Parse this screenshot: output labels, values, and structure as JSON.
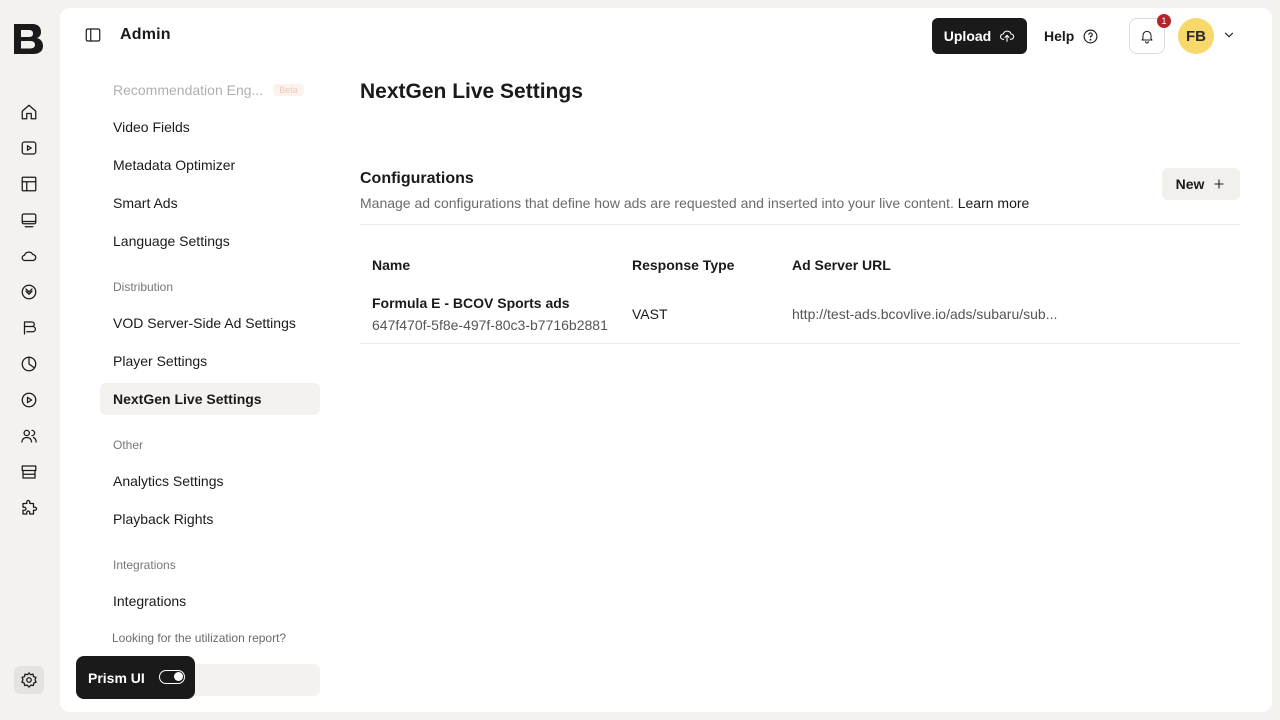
{
  "header": {
    "section": "Admin",
    "upload_label": "Upload",
    "help_label": "Help",
    "notification_count": "1",
    "avatar_initials": "FB"
  },
  "rail": {
    "icons": [
      "home-icon",
      "video-icon",
      "layout-icon",
      "monitor-icon",
      "cloud-icon",
      "badge-icon",
      "brand-icon",
      "analytics-icon",
      "play-icon",
      "users-icon",
      "store-icon",
      "puzzle-icon",
      "settings-icon"
    ]
  },
  "nav": {
    "partial_item": "Recommendation Eng...",
    "partial_badge": "Beta",
    "items_top": [
      "Video Fields",
      "Metadata Optimizer",
      "Smart Ads",
      "Language Settings"
    ],
    "group_distribution": "Distribution",
    "items_distribution": [
      "VOD Server-Side Ad Settings",
      "Player Settings",
      "NextGen Live Settings"
    ],
    "group_other": "Other",
    "items_other": [
      "Analytics Settings",
      "Playback Rights"
    ],
    "group_integrations": "Integrations",
    "items_integrations": [
      "Integrations"
    ],
    "note": "Looking for the utilization report?"
  },
  "content": {
    "title": "NextGen Live Settings",
    "section_title": "Configurations",
    "section_desc": "Manage ad configurations that define how ads are requested and inserted into your live content.",
    "learn_more": "Learn more",
    "new_label": "New",
    "columns": [
      "Name",
      "Response Type",
      "Ad Server URL"
    ],
    "rows": [
      {
        "name": "Formula E - BCOV Sports ads",
        "id": "647f470f-5f8e-497f-80c3-b7716b2881",
        "response_type": "VAST",
        "url": "http://test-ads.bcovlive.io/ads/subaru/sub..."
      }
    ]
  },
  "prism": {
    "label": "Prism UI",
    "enabled": true
  },
  "colors": {
    "accent_dark": "#1a1a1a",
    "avatar": "#f7d96b",
    "badge": "#b3262d"
  }
}
